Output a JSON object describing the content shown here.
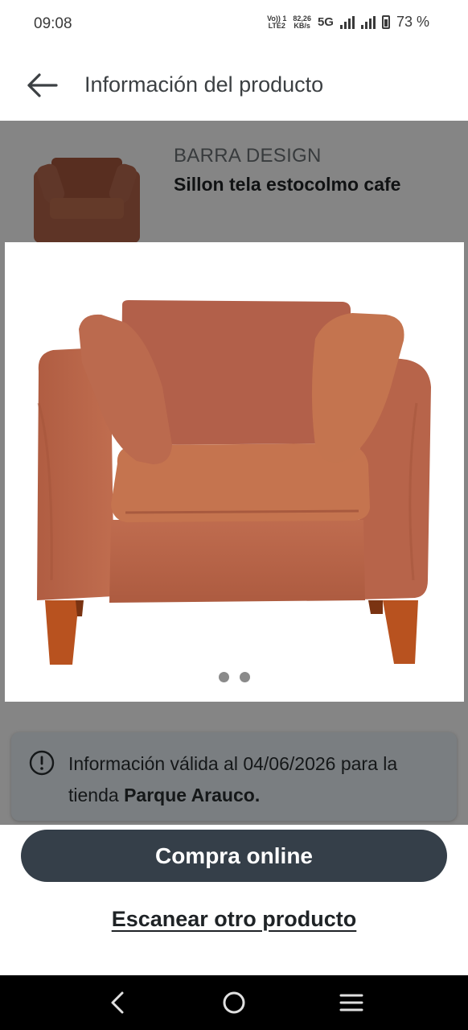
{
  "status_bar": {
    "time": "09:08",
    "network_top": "Vo)) 1",
    "network_bottom": "LTE2",
    "speed_value": "82,26",
    "speed_unit": "KB/s",
    "network_type": "5G",
    "battery_percent": "73 %",
    "battery_level": 0.73
  },
  "header": {
    "back_icon": "arrow-left-icon",
    "title": "Información del producto"
  },
  "product": {
    "brand": "BARRA DESIGN",
    "name": "Sillon tela estocolmo cafe"
  },
  "gallery": {
    "image_subject": "armchair-photo",
    "page_count": 2,
    "current_page": 1
  },
  "notice": {
    "icon": "info-icon",
    "text_prefix": "Información válida al 04/06/2026 para la tienda",
    "store": "Parque Arauco."
  },
  "actions": {
    "buy_label": "Compra online",
    "scan_label": "Escanear otro producto"
  },
  "nav_bar": {
    "back_icon": "nav-back-icon",
    "home_icon": "nav-home-icon",
    "recents_icon": "nav-recents-icon"
  },
  "colors": {
    "button_bg": "#353f49",
    "notice_bg": "#eaf1f8",
    "chair": "#b5644a"
  }
}
